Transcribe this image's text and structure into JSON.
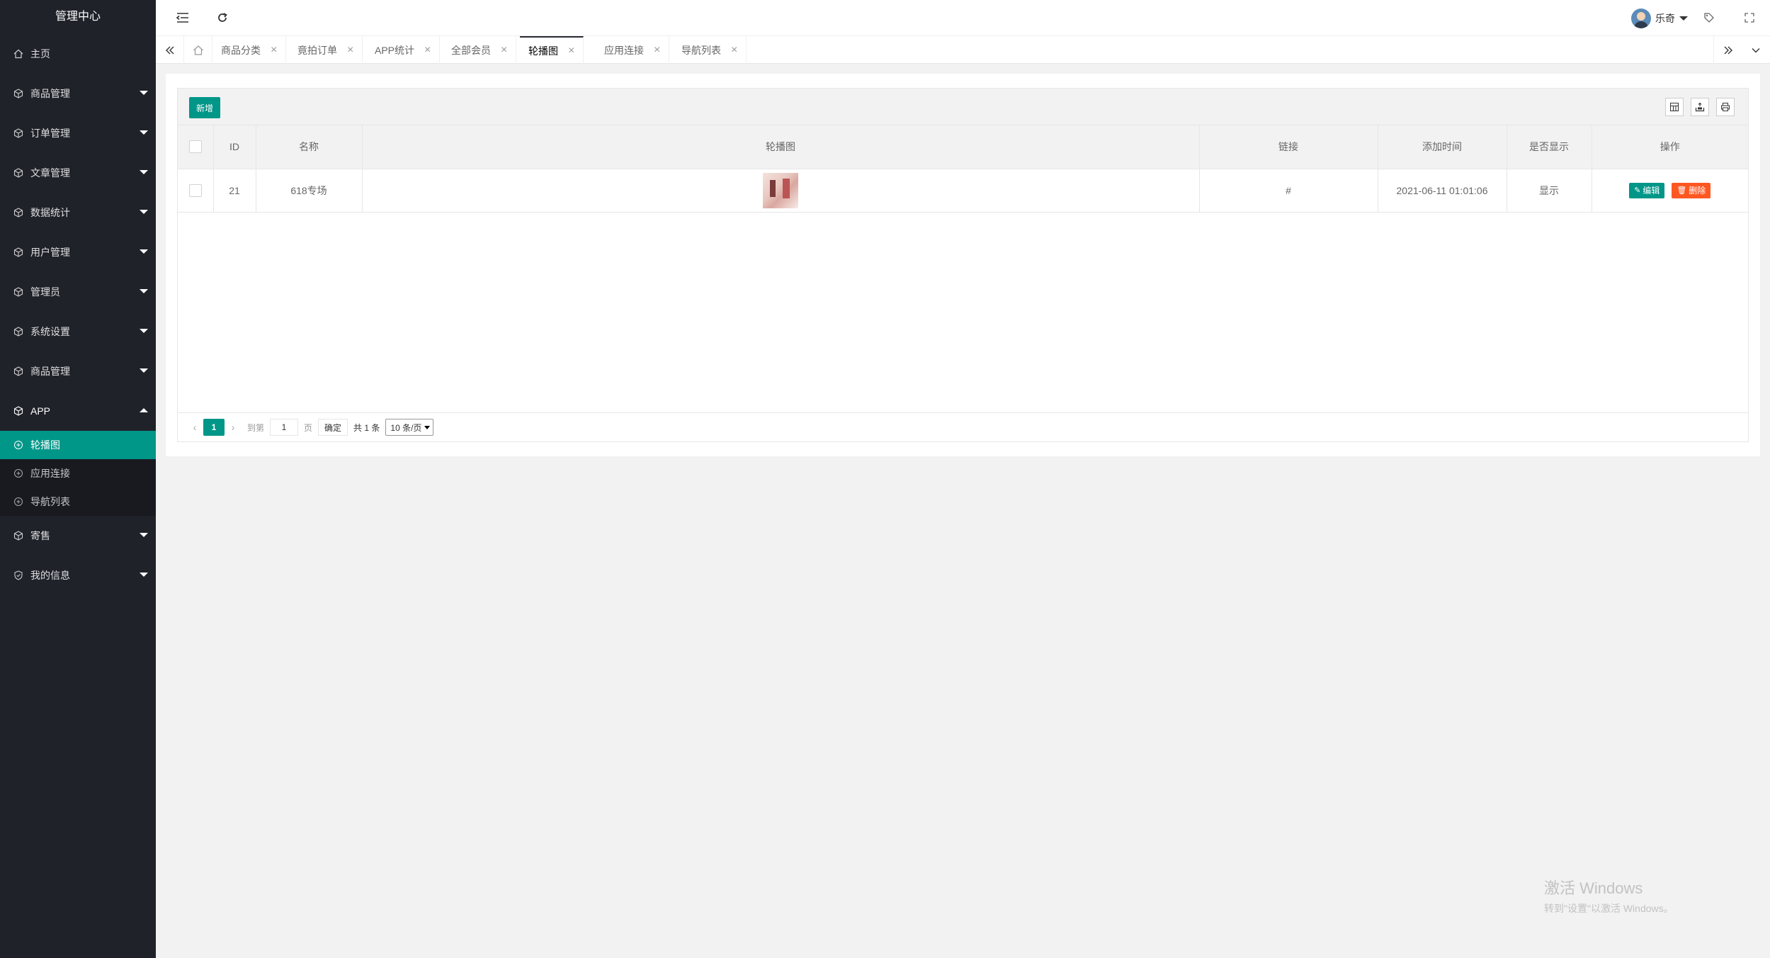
{
  "sidebar": {
    "title": "管理中心",
    "home": "主页",
    "items": [
      {
        "label": "商品管理"
      },
      {
        "label": "订单管理"
      },
      {
        "label": "文章管理"
      },
      {
        "label": "数据统计"
      },
      {
        "label": "用户管理"
      },
      {
        "label": "管理员"
      },
      {
        "label": "系统设置"
      },
      {
        "label": "商品管理"
      },
      {
        "label": "APP"
      }
    ],
    "app_sub": [
      {
        "label": "轮播图"
      },
      {
        "label": "应用连接"
      },
      {
        "label": "导航列表"
      }
    ],
    "after": [
      {
        "label": "寄售"
      },
      {
        "label": "我的信息"
      }
    ]
  },
  "header": {
    "username": "乐奇"
  },
  "tabs": [
    {
      "label": "商品分类"
    },
    {
      "label": "竟拍订单"
    },
    {
      "label": "APP统计"
    },
    {
      "label": "全部会员"
    },
    {
      "label": "轮播图"
    },
    {
      "label": "应用连接"
    },
    {
      "label": "导航列表"
    }
  ],
  "toolbar": {
    "add_label": "新增"
  },
  "table": {
    "columns": [
      "ID",
      "名称",
      "轮播图",
      "链接",
      "添加时间",
      "是否显示",
      "操作"
    ],
    "rows": [
      {
        "id": "21",
        "name": "618专场",
        "link": "#",
        "time": "2021-06-11 01:01:06",
        "show": "显示"
      }
    ],
    "edit_label": "编辑",
    "delete_label": "删除"
  },
  "pager": {
    "current": "1",
    "goto_label": "到第",
    "page_input": "1",
    "page_unit": "页",
    "confirm": "确定",
    "total": "共 1 条",
    "page_size": "10 条/页"
  },
  "watermark": {
    "line1": "激活 Windows",
    "line2": "转到\"设置\"以激活 Windows。"
  }
}
